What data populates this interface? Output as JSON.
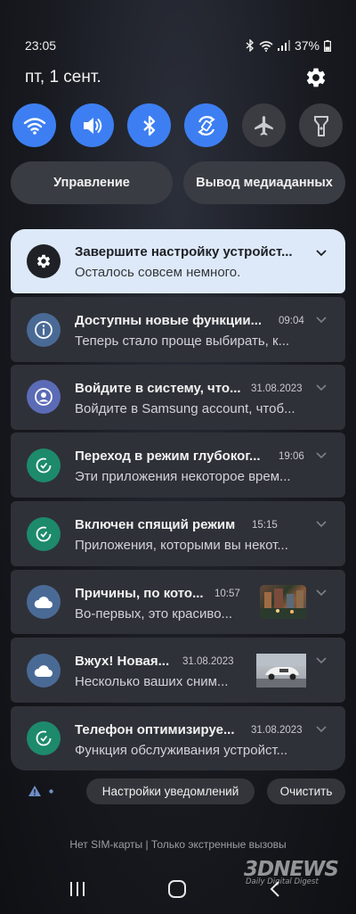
{
  "status": {
    "time": "23:05",
    "battery": "37%"
  },
  "header": {
    "date": "пт, 1 сент."
  },
  "quick_settings": [
    {
      "name": "wifi",
      "state": "on"
    },
    {
      "name": "sound",
      "state": "on"
    },
    {
      "name": "bluetooth",
      "state": "on"
    },
    {
      "name": "auto-rotate",
      "state": "on"
    },
    {
      "name": "airplane",
      "state": "off"
    },
    {
      "name": "flashlight",
      "state": "off"
    }
  ],
  "pills": {
    "control": "Управление",
    "media_output": "Вывод медиаданных"
  },
  "notifications": [
    {
      "title": "Завершите настройку устройст...",
      "time": "",
      "text": "Осталось совсем немного.",
      "icon": "gear-icon"
    },
    {
      "title": "Доступны новые функции...",
      "time": "09:04",
      "text": "Теперь стало проще выбирать, к...",
      "icon": "info-icon"
    },
    {
      "title": "Войдите в систему, что...",
      "time": "31.08.2023",
      "text": "Войдите в Samsung account, чтоб...",
      "icon": "account-icon"
    },
    {
      "title": "Переход в режим глубоког...",
      "time": "19:06",
      "text": "Эти приложения некоторое врем...",
      "icon": "device-care-icon"
    },
    {
      "title": "Включен спящий режим",
      "time": "15:15",
      "text": "Приложения, которыми вы некот...",
      "icon": "device-care-icon"
    },
    {
      "title": "Причины, по кото...",
      "time": "10:57",
      "text": "Во-первых, это красиво...",
      "icon": "cloud-icon"
    },
    {
      "title": "Вжух! Новая...",
      "time": "31.08.2023",
      "text": "Несколько ваших сним...",
      "icon": "cloud-icon"
    },
    {
      "title": "Телефон оптимизируе...",
      "time": "31.08.2023",
      "text": "Функция обслуживания устройст...",
      "icon": "device-care-icon"
    }
  ],
  "footer": {
    "notification_settings": "Настройки уведомлений",
    "clear": "Очистить",
    "sim_status": "Нет SIM-карты | Только экстренные вызовы"
  },
  "watermark": {
    "brand": "3DNEWS",
    "tagline": "Daily Digital Digest"
  },
  "colors": {
    "accent": "#3d7ff2",
    "first_card": "#dde9f8",
    "card": "#2f3138"
  }
}
